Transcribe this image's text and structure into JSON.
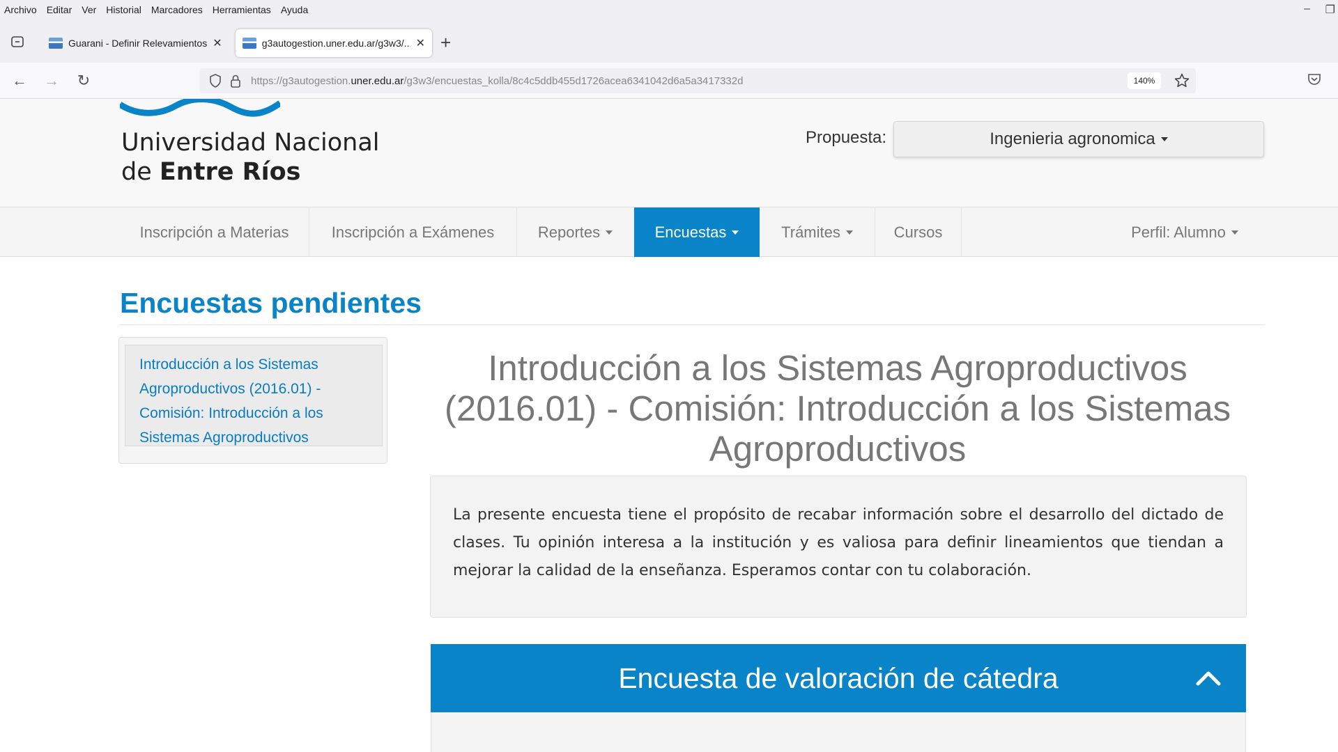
{
  "browser": {
    "menu": [
      "Archivo",
      "Editar",
      "Ver",
      "Historial",
      "Marcadores",
      "Herramientas",
      "Ayuda"
    ],
    "tabs": [
      {
        "title": "Guarani - Definir Relevamientos"
      },
      {
        "title": "g3autogestion.uner.edu.ar/g3w3/..."
      }
    ],
    "url_prefix": "https://g3autogestion.",
    "url_host": "uner.edu.ar",
    "url_path": "/g3w3/encuestas_kolla/8c4c5ddb455d1726acea6341042d6a5a3417332d",
    "zoom": "140%"
  },
  "header": {
    "logo_line1": "Universidad Nacional",
    "logo_line2_a": "de ",
    "logo_line2_b": "Entre Ríos",
    "propuesta_label": "Propuesta:",
    "propuesta_value": "Ingenieria agronomica"
  },
  "nav": {
    "materias": "Inscripción a Materias",
    "examenes": "Inscripción a Exámenes",
    "reportes": "Reportes",
    "encuestas": "Encuestas",
    "tramites": "Trámites",
    "cursos": "Cursos",
    "perfil": "Perfil: Alumno"
  },
  "content": {
    "page_title": "Encuestas pendientes",
    "side_link": "Introducción a los Sistemas Agroproductivos (2016.01) - Comisión: Introducción a los Sistemas Agroproductivos",
    "survey_title": "Introducción a los Sistemas Agroproductivos (2016.01) - Comisión: Introducción a los Sistemas Agroproductivos",
    "intro_text": "La presente encuesta tiene el propósito de recabar información sobre el desarrollo del dictado de clases. Tu opinión interesa a la institución y es valiosa para definir lineamientos que tiendan a mejorar la calidad de la enseñanza. Esperamos contar con tu colaboración.",
    "section_title": "Encuesta de valoración de cátedra"
  },
  "colors": {
    "brand_blue": "#0a84c9",
    "link_blue": "#0a7cc0"
  },
  "icons": [
    "tab-list-icon",
    "site-favicon-icon",
    "close-icon",
    "plus-icon",
    "back-arrow-icon",
    "forward-arrow-icon",
    "reload-icon",
    "shield-icon",
    "lock-icon",
    "star-icon",
    "pocket-icon",
    "chevron-up-icon"
  ]
}
